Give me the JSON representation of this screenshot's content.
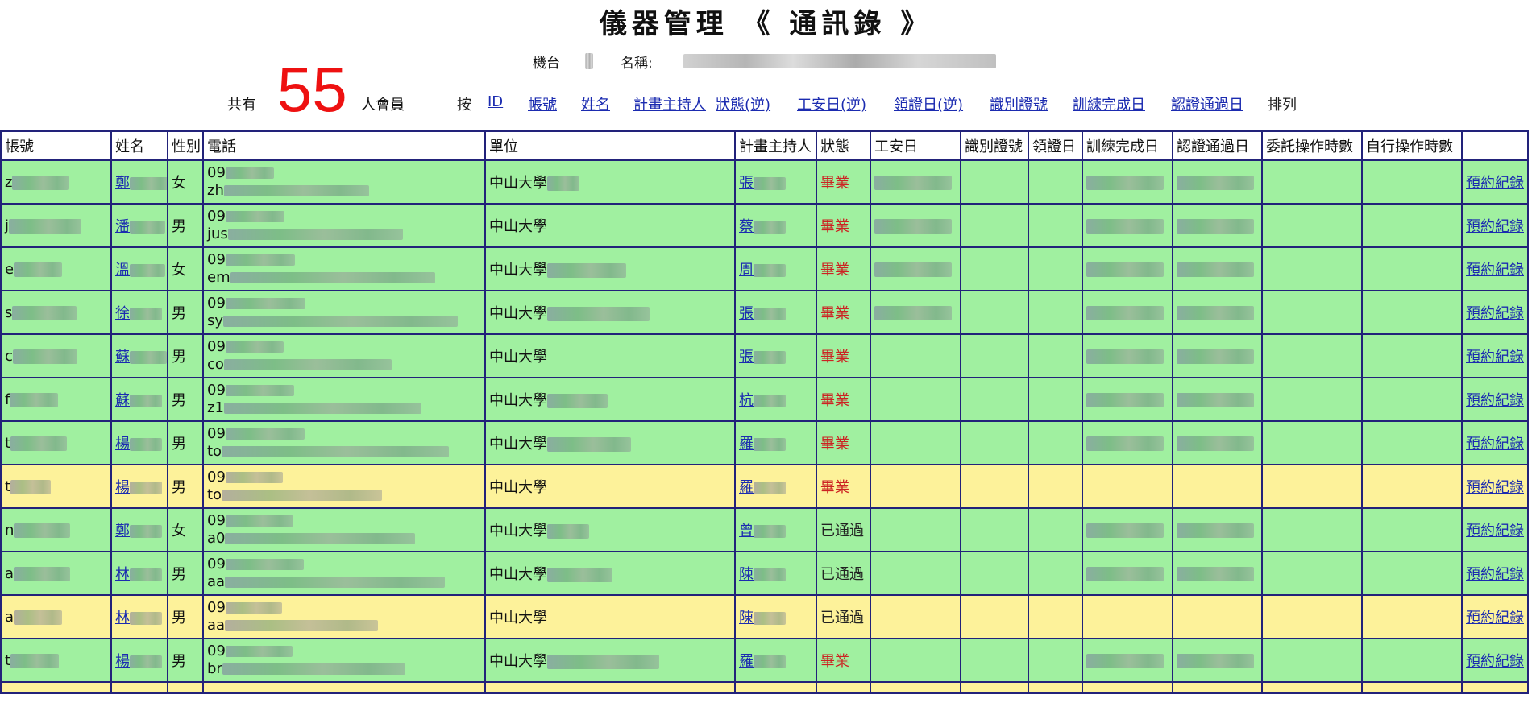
{
  "title": "儀器管理 《 通訊錄 》",
  "machine": {
    "machine_label": "機台",
    "name_label": "名稱:"
  },
  "summary": {
    "prefix": "共有",
    "count": "55",
    "suffix": "人會員"
  },
  "sort": {
    "prefix": "按",
    "links": [
      "ID",
      "帳號",
      "姓名",
      "計畫主持人",
      "狀態(逆)",
      "工安日(逆)",
      "領證日(逆)",
      "識別證號",
      "訓練完成日",
      "認證通過日"
    ],
    "suffix": "排列"
  },
  "table": {
    "headers": [
      "帳號",
      "姓名",
      "性別",
      "電話",
      "單位",
      "計畫主持人",
      "狀態",
      "工安日",
      "識別證號",
      "領證日",
      "訓練完成日",
      "認證通過日",
      "委託操作時數",
      "自行操作時數",
      ""
    ],
    "row_colors": {
      "green": "#a0f0a0",
      "yellow": "#fdf29a"
    },
    "rows": [
      {
        "color": "green",
        "account": "z",
        "name": "鄭",
        "gender": "女",
        "phone1": "09",
        "phone2": "zh",
        "unit": "中山大學",
        "pi": "張",
        "status": "畢業",
        "status_color": "#cc2222",
        "has_safety": true,
        "action": "預約紀錄"
      },
      {
        "color": "green",
        "account": "j",
        "name": "潘",
        "gender": "男",
        "phone1": "09",
        "phone2": "jus",
        "unit": "中山大學",
        "pi": "蔡",
        "status": "畢業",
        "status_color": "#cc2222",
        "has_safety": true,
        "action": "預約紀錄"
      },
      {
        "color": "green",
        "account": "e",
        "name": "溫",
        "gender": "女",
        "phone1": "09",
        "phone2": "em",
        "unit": "中山大學",
        "pi": "周",
        "status": "畢業",
        "status_color": "#cc2222",
        "has_safety": true,
        "action": "預約紀錄"
      },
      {
        "color": "green",
        "account": "s",
        "name": "徐",
        "gender": "男",
        "phone1": "09",
        "phone2": "sy",
        "unit": "中山大學",
        "pi": "張",
        "status": "畢業",
        "status_color": "#cc2222",
        "has_safety": true,
        "action": "預約紀錄"
      },
      {
        "color": "green",
        "account": "c",
        "name": "蘇",
        "gender": "男",
        "phone1": "09",
        "phone2": "co",
        "unit": "中山大學",
        "pi": "張",
        "status": "畢業",
        "status_color": "#cc2222",
        "has_safety": false,
        "action": "預約紀錄"
      },
      {
        "color": "green",
        "account": "f",
        "name": "蘇",
        "gender": "男",
        "phone1": "09",
        "phone2": "z1",
        "unit": "中山大學",
        "pi": "杭",
        "status": "畢業",
        "status_color": "#cc2222",
        "has_safety": false,
        "action": "預約紀錄"
      },
      {
        "color": "green",
        "account": "t",
        "name": "楊",
        "gender": "男",
        "phone1": "09",
        "phone2": "to",
        "unit": "中山大學",
        "pi": "羅",
        "status": "畢業",
        "status_color": "#cc2222",
        "has_safety": false,
        "action": "預約紀錄"
      },
      {
        "color": "yellow",
        "account": "t",
        "name": "楊",
        "gender": "男",
        "phone1": "09",
        "phone2": "to",
        "unit": "中山大學",
        "pi": "羅",
        "status": "畢業",
        "status_color": "#cc2222",
        "has_safety": false,
        "action": "預約紀錄"
      },
      {
        "color": "green",
        "account": "n",
        "name": "鄭",
        "gender": "女",
        "phone1": "09",
        "phone2": "a0",
        "unit": "中山大學",
        "pi": "曾",
        "status": "已通過",
        "status_color": "#222222",
        "has_safety": false,
        "action": "預約紀錄"
      },
      {
        "color": "green",
        "account": "a",
        "name": "林",
        "gender": "男",
        "phone1": "09",
        "phone2": "aa",
        "unit": "中山大學",
        "pi": "陳",
        "status": "已通過",
        "status_color": "#222222",
        "has_safety": false,
        "action": "預約紀錄"
      },
      {
        "color": "yellow",
        "account": "a",
        "name": "林",
        "gender": "男",
        "phone1": "09",
        "phone2": "aa",
        "unit": "中山大學",
        "pi": "陳",
        "status": "已通過",
        "status_color": "#222222",
        "has_safety": false,
        "action": "預約紀錄"
      },
      {
        "color": "green",
        "account": "t",
        "name": "楊",
        "gender": "男",
        "phone1": "09",
        "phone2": "br",
        "unit": "中山大學",
        "pi": "羅",
        "status": "畢業",
        "status_color": "#cc2222",
        "has_safety": false,
        "action": "預約紀錄"
      }
    ]
  }
}
